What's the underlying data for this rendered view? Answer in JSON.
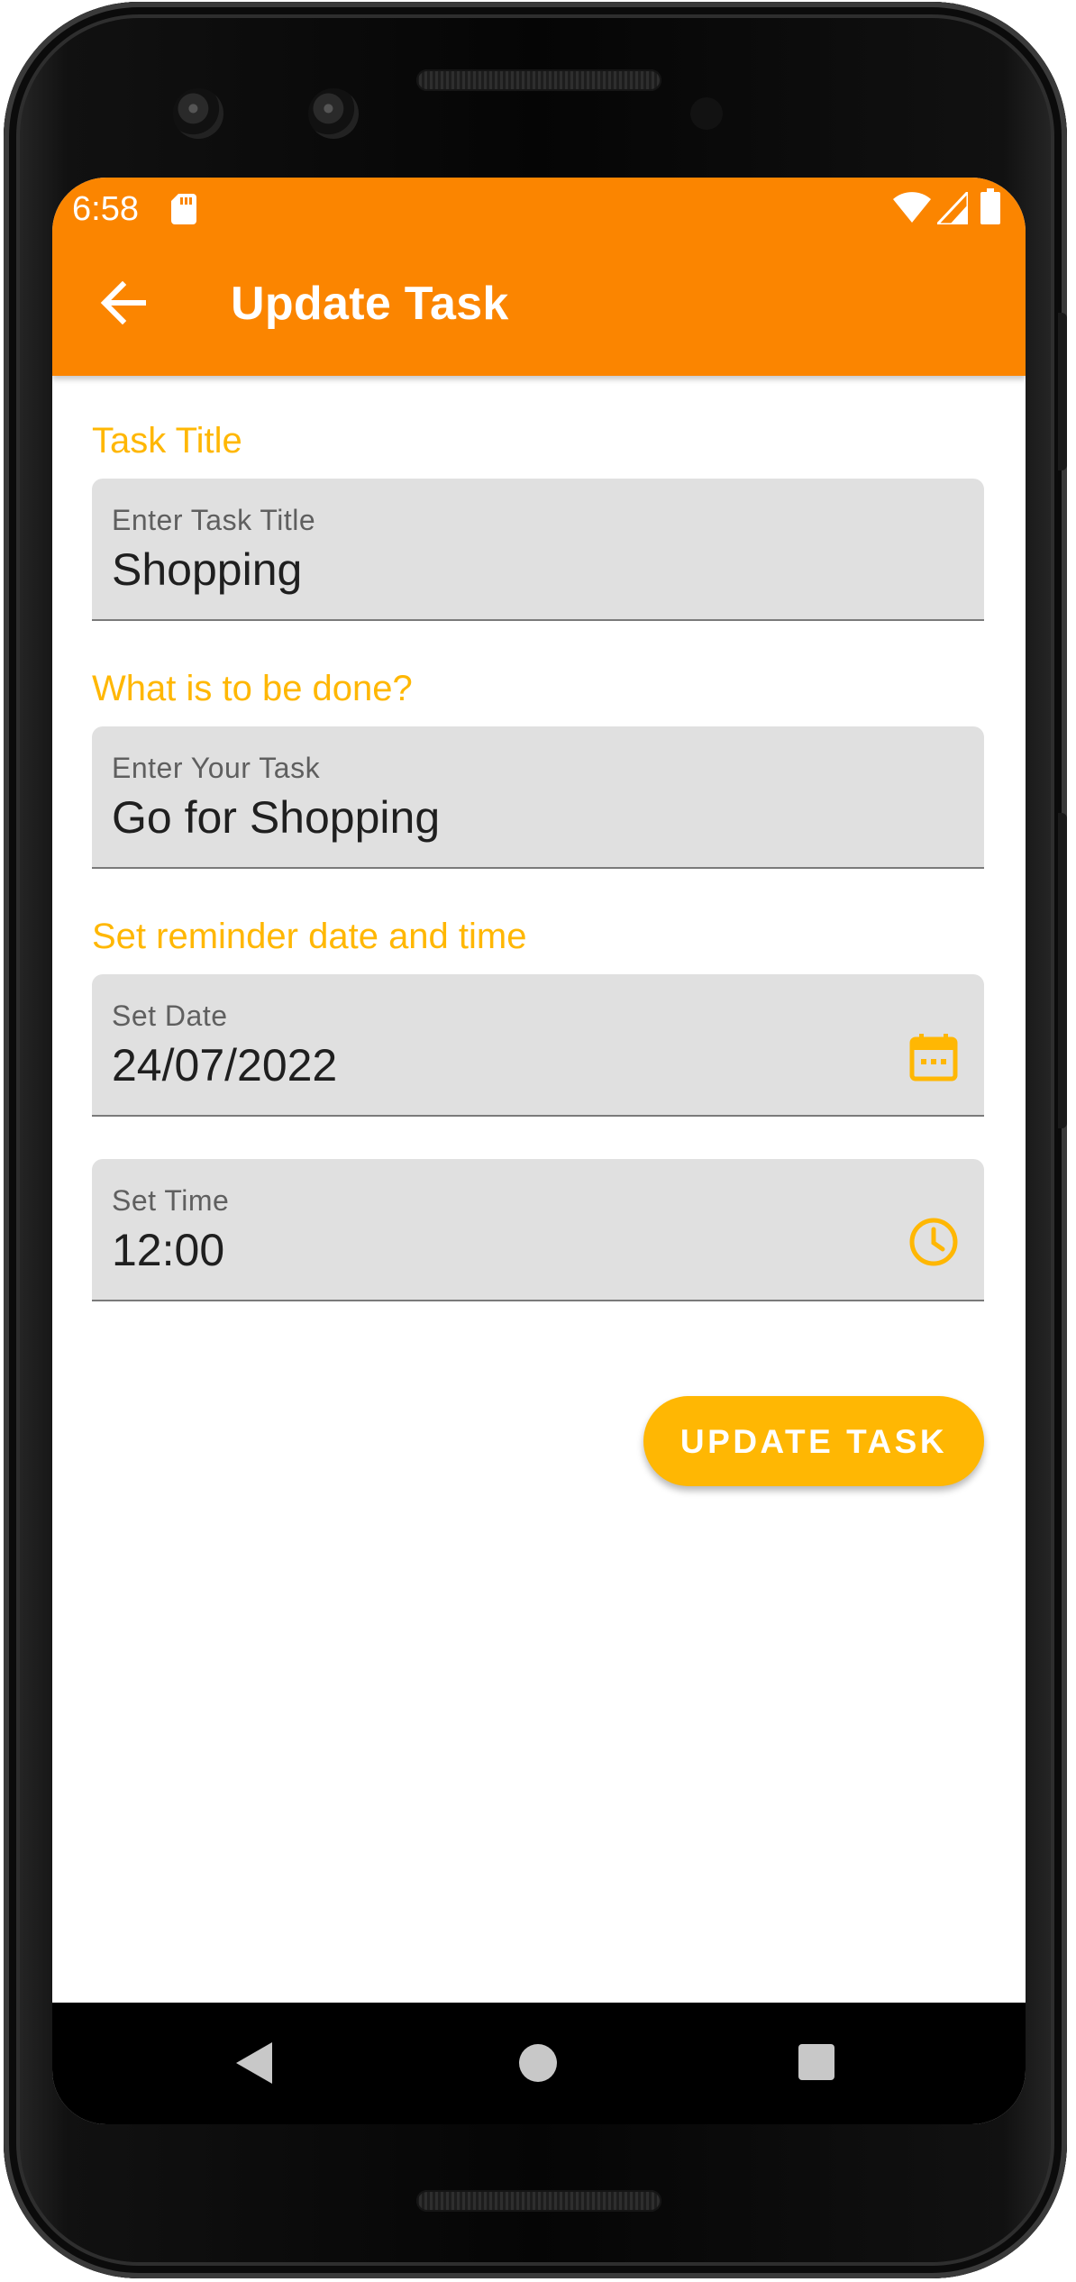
{
  "status_bar": {
    "time": "6:58",
    "icons": [
      "sd-card-icon",
      "wifi-icon",
      "signal-icon",
      "battery-icon"
    ]
  },
  "app_bar": {
    "title": "Update Task",
    "back_icon": "arrow-back-icon"
  },
  "form": {
    "title_section": {
      "heading": "Task Title",
      "label": "Enter Task Title",
      "value": "Shopping"
    },
    "task_section": {
      "heading": "What is to be done?",
      "label": "Enter Your Task",
      "value": "Go for Shopping"
    },
    "reminder_section": {
      "heading": "Set reminder date and time",
      "date": {
        "label": "Set Date",
        "value": "24/07/2022",
        "icon": "calendar-icon"
      },
      "time": {
        "label": "Set Time",
        "value": "12:00",
        "icon": "clock-icon"
      }
    },
    "submit_label": "UPDATE TASK"
  },
  "nav_bar": {
    "buttons": [
      "back-triangle-icon",
      "home-circle-icon",
      "recents-square-icon"
    ]
  },
  "colors": {
    "app_bar": "#FB8500",
    "accent": "#FFB703",
    "field_background": "#E0E0E0"
  }
}
